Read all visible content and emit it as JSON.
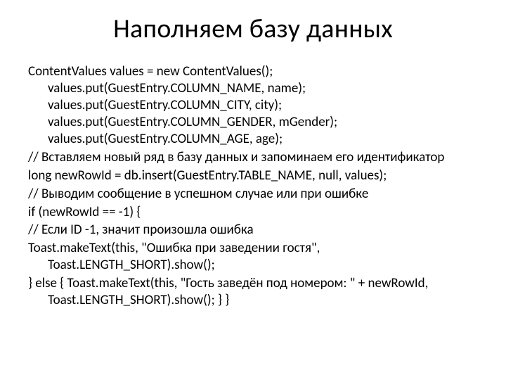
{
  "title": "Наполняем базу данных",
  "lines": {
    "l1": "ContentValues values = new ContentValues(); values.put(GuestEntry.COLUMN_NAME, name); values.put(GuestEntry.COLUMN_CITY, city); values.put(GuestEntry.COLUMN_GENDER, mGender); values.put(GuestEntry.COLUMN_AGE, age);",
    "l2": "// Вставляем новый ряд в базу данных и запоминаем его идентификатор",
    "l3": " long newRowId = db.insert(GuestEntry.TABLE_NAME, null, values);",
    "l4": "// Выводим сообщение в успешном случае или при ошибке",
    "l5": "if (newRowId == -1) {",
    "l6": "// Если ID -1, значит произошла ошибка",
    "l7": " Toast.makeText(this, \"Ошибка при заведении гостя\", Toast.LENGTH_SHORT).show();",
    "l8": "} else { Toast.makeText(this, \"Гость заведён под номером: \" + newRowId, Toast.LENGTH_SHORT).show(); } }"
  }
}
